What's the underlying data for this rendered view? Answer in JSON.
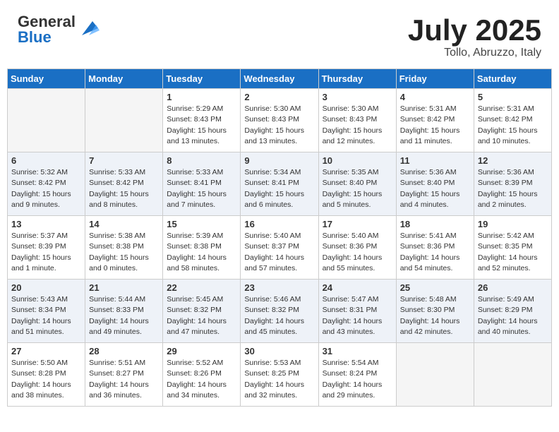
{
  "header": {
    "logo_general": "General",
    "logo_blue": "Blue",
    "month_title": "July 2025",
    "location": "Tollo, Abruzzo, Italy"
  },
  "weekdays": [
    "Sunday",
    "Monday",
    "Tuesday",
    "Wednesday",
    "Thursday",
    "Friday",
    "Saturday"
  ],
  "weeks": [
    [
      {
        "day": "",
        "empty": true
      },
      {
        "day": "",
        "empty": true
      },
      {
        "day": "1",
        "sunrise": "Sunrise: 5:29 AM",
        "sunset": "Sunset: 8:43 PM",
        "daylight": "Daylight: 15 hours and 13 minutes."
      },
      {
        "day": "2",
        "sunrise": "Sunrise: 5:30 AM",
        "sunset": "Sunset: 8:43 PM",
        "daylight": "Daylight: 15 hours and 13 minutes."
      },
      {
        "day": "3",
        "sunrise": "Sunrise: 5:30 AM",
        "sunset": "Sunset: 8:43 PM",
        "daylight": "Daylight: 15 hours and 12 minutes."
      },
      {
        "day": "4",
        "sunrise": "Sunrise: 5:31 AM",
        "sunset": "Sunset: 8:42 PM",
        "daylight": "Daylight: 15 hours and 11 minutes."
      },
      {
        "day": "5",
        "sunrise": "Sunrise: 5:31 AM",
        "sunset": "Sunset: 8:42 PM",
        "daylight": "Daylight: 15 hours and 10 minutes."
      }
    ],
    [
      {
        "day": "6",
        "sunrise": "Sunrise: 5:32 AM",
        "sunset": "Sunset: 8:42 PM",
        "daylight": "Daylight: 15 hours and 9 minutes."
      },
      {
        "day": "7",
        "sunrise": "Sunrise: 5:33 AM",
        "sunset": "Sunset: 8:42 PM",
        "daylight": "Daylight: 15 hours and 8 minutes."
      },
      {
        "day": "8",
        "sunrise": "Sunrise: 5:33 AM",
        "sunset": "Sunset: 8:41 PM",
        "daylight": "Daylight: 15 hours and 7 minutes."
      },
      {
        "day": "9",
        "sunrise": "Sunrise: 5:34 AM",
        "sunset": "Sunset: 8:41 PM",
        "daylight": "Daylight: 15 hours and 6 minutes."
      },
      {
        "day": "10",
        "sunrise": "Sunrise: 5:35 AM",
        "sunset": "Sunset: 8:40 PM",
        "daylight": "Daylight: 15 hours and 5 minutes."
      },
      {
        "day": "11",
        "sunrise": "Sunrise: 5:36 AM",
        "sunset": "Sunset: 8:40 PM",
        "daylight": "Daylight: 15 hours and 4 minutes."
      },
      {
        "day": "12",
        "sunrise": "Sunrise: 5:36 AM",
        "sunset": "Sunset: 8:39 PM",
        "daylight": "Daylight: 15 hours and 2 minutes."
      }
    ],
    [
      {
        "day": "13",
        "sunrise": "Sunrise: 5:37 AM",
        "sunset": "Sunset: 8:39 PM",
        "daylight": "Daylight: 15 hours and 1 minute."
      },
      {
        "day": "14",
        "sunrise": "Sunrise: 5:38 AM",
        "sunset": "Sunset: 8:38 PM",
        "daylight": "Daylight: 15 hours and 0 minutes."
      },
      {
        "day": "15",
        "sunrise": "Sunrise: 5:39 AM",
        "sunset": "Sunset: 8:38 PM",
        "daylight": "Daylight: 14 hours and 58 minutes."
      },
      {
        "day": "16",
        "sunrise": "Sunrise: 5:40 AM",
        "sunset": "Sunset: 8:37 PM",
        "daylight": "Daylight: 14 hours and 57 minutes."
      },
      {
        "day": "17",
        "sunrise": "Sunrise: 5:40 AM",
        "sunset": "Sunset: 8:36 PM",
        "daylight": "Daylight: 14 hours and 55 minutes."
      },
      {
        "day": "18",
        "sunrise": "Sunrise: 5:41 AM",
        "sunset": "Sunset: 8:36 PM",
        "daylight": "Daylight: 14 hours and 54 minutes."
      },
      {
        "day": "19",
        "sunrise": "Sunrise: 5:42 AM",
        "sunset": "Sunset: 8:35 PM",
        "daylight": "Daylight: 14 hours and 52 minutes."
      }
    ],
    [
      {
        "day": "20",
        "sunrise": "Sunrise: 5:43 AM",
        "sunset": "Sunset: 8:34 PM",
        "daylight": "Daylight: 14 hours and 51 minutes."
      },
      {
        "day": "21",
        "sunrise": "Sunrise: 5:44 AM",
        "sunset": "Sunset: 8:33 PM",
        "daylight": "Daylight: 14 hours and 49 minutes."
      },
      {
        "day": "22",
        "sunrise": "Sunrise: 5:45 AM",
        "sunset": "Sunset: 8:32 PM",
        "daylight": "Daylight: 14 hours and 47 minutes."
      },
      {
        "day": "23",
        "sunrise": "Sunrise: 5:46 AM",
        "sunset": "Sunset: 8:32 PM",
        "daylight": "Daylight: 14 hours and 45 minutes."
      },
      {
        "day": "24",
        "sunrise": "Sunrise: 5:47 AM",
        "sunset": "Sunset: 8:31 PM",
        "daylight": "Daylight: 14 hours and 43 minutes."
      },
      {
        "day": "25",
        "sunrise": "Sunrise: 5:48 AM",
        "sunset": "Sunset: 8:30 PM",
        "daylight": "Daylight: 14 hours and 42 minutes."
      },
      {
        "day": "26",
        "sunrise": "Sunrise: 5:49 AM",
        "sunset": "Sunset: 8:29 PM",
        "daylight": "Daylight: 14 hours and 40 minutes."
      }
    ],
    [
      {
        "day": "27",
        "sunrise": "Sunrise: 5:50 AM",
        "sunset": "Sunset: 8:28 PM",
        "daylight": "Daylight: 14 hours and 38 minutes."
      },
      {
        "day": "28",
        "sunrise": "Sunrise: 5:51 AM",
        "sunset": "Sunset: 8:27 PM",
        "daylight": "Daylight: 14 hours and 36 minutes."
      },
      {
        "day": "29",
        "sunrise": "Sunrise: 5:52 AM",
        "sunset": "Sunset: 8:26 PM",
        "daylight": "Daylight: 14 hours and 34 minutes."
      },
      {
        "day": "30",
        "sunrise": "Sunrise: 5:53 AM",
        "sunset": "Sunset: 8:25 PM",
        "daylight": "Daylight: 14 hours and 32 minutes."
      },
      {
        "day": "31",
        "sunrise": "Sunrise: 5:54 AM",
        "sunset": "Sunset: 8:24 PM",
        "daylight": "Daylight: 14 hours and 29 minutes."
      },
      {
        "day": "",
        "empty": true
      },
      {
        "day": "",
        "empty": true
      }
    ]
  ]
}
